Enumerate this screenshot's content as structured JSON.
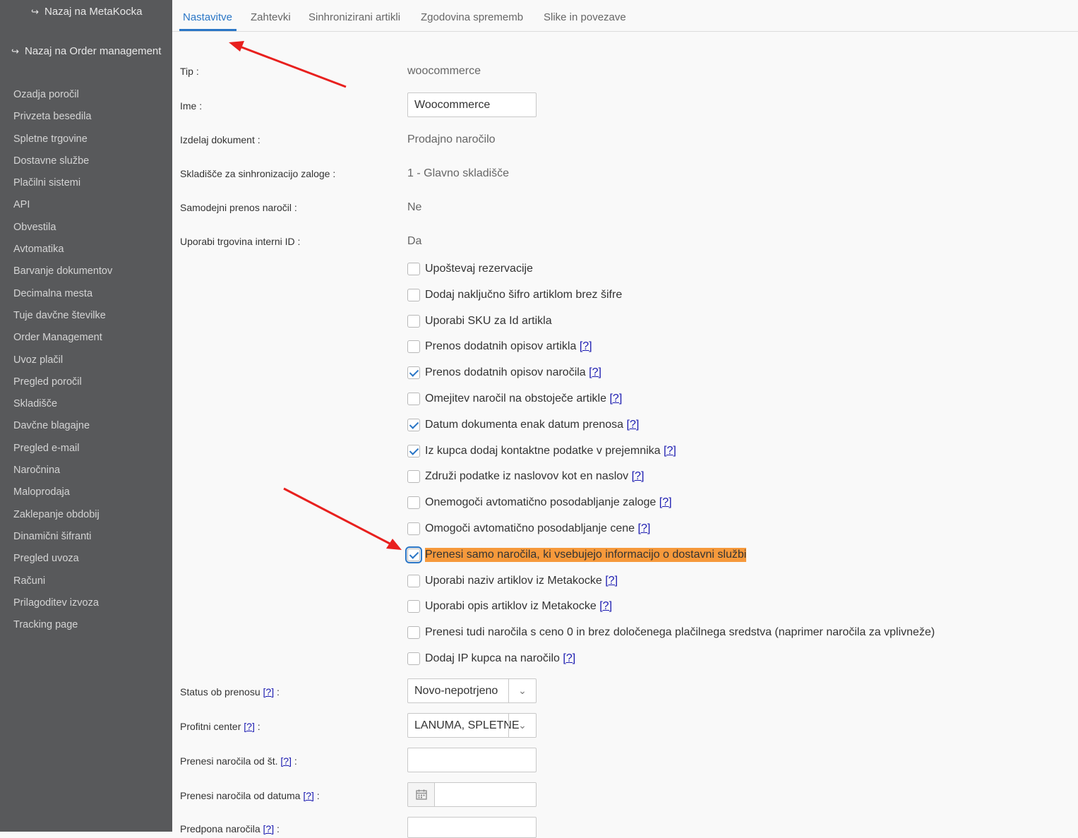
{
  "sidebar": {
    "back_metakocka": "Nazaj na MetaKocka",
    "back_order_mgmt": "Nazaj na Order management",
    "items": [
      "Ozadja poročil",
      "Privzeta besedila",
      "Spletne trgovine",
      "Dostavne službe",
      "Plačilni sistemi",
      "API",
      "Obvestila",
      "Avtomatika",
      "Barvanje dokumentov",
      "Decimalna mesta",
      "Tuje davčne številke",
      "Order Management",
      "Uvoz plačil",
      "Pregled poročil",
      "Skladišče",
      "Davčne blagajne",
      "Pregled e-mail",
      "Naročnina",
      "Maloprodaja",
      "Zaklepanje obdobij",
      "Dinamični šifranti",
      "Pregled uvoza",
      "Računi",
      "Prilagoditev izvoza",
      "Tracking page"
    ]
  },
  "tabs": [
    "Nastavitve",
    "Zahtevki",
    "Sinhronizirani artikli",
    "Zgodovina sprememb",
    "Slike in povezave"
  ],
  "active_tab": "Nastavitve",
  "accent_color": "#2a76c6",
  "highlight_color": "#f6993b",
  "form": {
    "tip_label": "Tip :",
    "tip_value": "woocommerce",
    "ime_label": "Ime :",
    "ime_value": "Woocommerce",
    "doc_label": "Izdelaj dokument :",
    "doc_value": "Prodajno naročilo",
    "wh_label": "Skladišče za sinhronizacijo zaloge :",
    "wh_value": "1 - Glavno skladišče",
    "auto_label": "Samodejni prenos naročil :",
    "auto_value": "Ne",
    "intid_label": "Uporabi trgovina interni ID :",
    "intid_value": "Da",
    "status_label": "Status ob prenosu",
    "status_value": "Novo-nepotrjeno",
    "profit_label": "Profitni center",
    "profit_value": "LANUMA, SPLETNE",
    "fromno_label": "Prenesi naročila od št.",
    "fromno_value": "",
    "fromdate_label": "Prenesi naročila od datuma",
    "fromdate_value": "",
    "prefix_label": "Predpona naročila",
    "help": "[?]",
    "colon": ":"
  },
  "checkboxes": [
    {
      "label": "Upoštevaj rezervacije",
      "checked": false,
      "help": ""
    },
    {
      "label": "Dodaj naključno šifro artiklom brez šifre",
      "checked": false,
      "help": ""
    },
    {
      "label": "Uporabi SKU za Id artikla",
      "checked": false,
      "help": ""
    },
    {
      "label": "Prenos dodatnih opisov artikla",
      "checked": false,
      "help": "[?]"
    },
    {
      "label": "Prenos dodatnih opisov naročila",
      "checked": true,
      "help": "[?]"
    },
    {
      "label": "Omejitev naročil na obstoječe artikle",
      "checked": false,
      "help": "[?]"
    },
    {
      "label": "Datum dokumenta enak datum prenosa",
      "checked": true,
      "help": "[?]"
    },
    {
      "label": "Iz kupca dodaj kontaktne podatke v prejemnika",
      "checked": true,
      "help": "[?]"
    },
    {
      "label": "Združi podatke iz naslovov kot en naslov",
      "checked": false,
      "help": "[?]"
    },
    {
      "label": "Onemogoči avtomatično posodabljanje zaloge",
      "checked": false,
      "help": "[?]"
    },
    {
      "label": "Omogoči avtomatično posodabljanje cene",
      "checked": false,
      "help": "[?]"
    },
    {
      "label": "Prenesi samo naročila, ki vsebujejo informacijo o dostavni službi",
      "checked": true,
      "help": "",
      "highlighted": true
    },
    {
      "label": "Uporabi naziv artiklov iz Metakocke",
      "checked": false,
      "help": "[?]"
    },
    {
      "label": "Uporabi opis artiklov iz Metakocke",
      "checked": false,
      "help": "[?]"
    },
    {
      "label": "Prenesi tudi naročila s ceno 0 in brez določenega plačilnega sredstva (naprimer naročila za vplivneže)",
      "checked": false,
      "help": ""
    },
    {
      "label": "Dodaj IP kupca na naročilo",
      "checked": false,
      "help": "[?]"
    }
  ]
}
